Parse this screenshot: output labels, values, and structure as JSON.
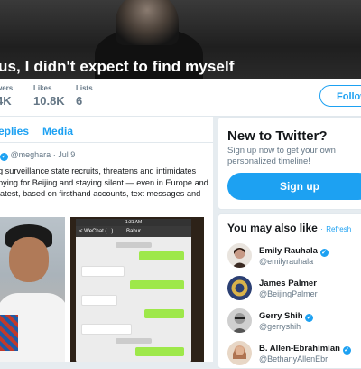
{
  "banner": {
    "caption": "us, I didn't expect to find myself"
  },
  "stats": {
    "followers": {
      "label": "wers",
      "value": "4K"
    },
    "likes": {
      "label": "Likes",
      "value": "10.8K"
    },
    "lists": {
      "label": "Lists",
      "value": "6"
    },
    "follow_label": "Follow"
  },
  "tabs": [
    {
      "label": "eplies"
    },
    {
      "label": "Media"
    }
  ],
  "tweet": {
    "handle": "@meghara",
    "separator": "·",
    "date": "Jul 9",
    "lines": [
      "g surveillance state recruits, threatens and intimidates",
      "pying for Beijing and staying silent — even in Europe and",
      "latest, based on firsthand accounts, text messages and"
    ],
    "phone": {
      "status_time": "1:31 AM",
      "back_label": "< WeChat (...)",
      "chat_title": "Babur"
    }
  },
  "new_to_twitter": {
    "title": "New to Twitter?",
    "description": "Sign up now to get your own personalized timeline!",
    "signup_label": "Sign up"
  },
  "suggestions": {
    "title": "You may also like",
    "separator": "·",
    "refresh_label": "Refresh",
    "items": [
      {
        "name": "Emily Rauhala",
        "handle": "@emilyrauhala",
        "avatar_color": "#c79a86"
      },
      {
        "name": "James Palmer",
        "handle": "@BeijingPalmer",
        "avatar_color": "#2b3f73"
      },
      {
        "name": "Gerry Shih",
        "handle": "@gerryshih",
        "avatar_color": "#8a8a8a"
      },
      {
        "name": "B. Allen-Ebrahimian",
        "handle": "@BethanyAllenEbr",
        "avatar_color": "#a4633d"
      }
    ]
  },
  "colors": {
    "accent": "#1da1f2",
    "background": "#e6ecf0",
    "secondary_text": "#657786"
  }
}
